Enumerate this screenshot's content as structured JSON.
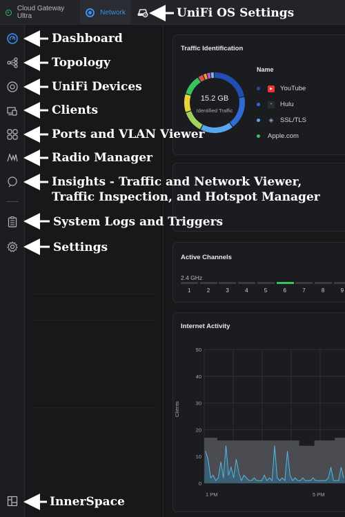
{
  "topbar": {
    "gateway_tab": "Cloud Gateway Ultra",
    "network_tab": "Network"
  },
  "annotations": {
    "os_settings": "UniFi OS Settings",
    "dashboard": "Dashboard",
    "topology": "Topology",
    "devices": "UniFi Devices",
    "clients": "Clients",
    "ports": "Ports and VLAN Viewer",
    "radio": "Radio Manager",
    "insights_line1": "Insights - Traffic and Network Viewer,",
    "insights_line2": "Traffic Inspection, and Hotspot Manager",
    "logs": "System Logs and Triggers",
    "settings": "Settings",
    "innerspace": "InnerSpace"
  },
  "traffic_card": {
    "title": "Traffic Identification",
    "total": "15.2 GB",
    "total_label": "Identified Traffic",
    "legend_header": "Name",
    "legend": [
      {
        "name": "YouTube",
        "color": "#1f4fb3",
        "icon": "youtube-icon"
      },
      {
        "name": "Hulu",
        "color": "#2f6bd6",
        "icon": "hulu-icon"
      },
      {
        "name": "SSL/TLS",
        "color": "#5aa5f0",
        "icon": "shield-icon"
      },
      {
        "name": "Apple.com",
        "color": "#3ac25c",
        "icon": "apple-icon"
      }
    ],
    "donut": [
      {
        "color": "#1f4fb3",
        "value": 22
      },
      {
        "color": "#2f6bd6",
        "value": 18
      },
      {
        "color": "#5aa5f0",
        "value": 18
      },
      {
        "color": "#9fd45a",
        "value": 12
      },
      {
        "color": "#e8d23a",
        "value": 10
      },
      {
        "color": "#3ac25c",
        "value": 11
      },
      {
        "color": "#e05050",
        "value": 3
      },
      {
        "color": "#f09a3a",
        "value": 2
      },
      {
        "color": "#c65ad6",
        "value": 2
      },
      {
        "color": "#7fb3f5",
        "value": 2
      }
    ]
  },
  "channels_card": {
    "title": "Active Channels",
    "band": "2.4 GHz",
    "channels": [
      "1",
      "2",
      "3",
      "4",
      "5",
      "6",
      "7",
      "8",
      "9"
    ],
    "active_channel": "6"
  },
  "internet_card": {
    "title": "Internet Activity",
    "ylabel": "Clients",
    "x_ticks": [
      "1 PM",
      "5 PM"
    ]
  },
  "chart_data": {
    "type": "area",
    "title": "Internet Activity",
    "ylabel": "Clients",
    "ylim": [
      0,
      50
    ],
    "yticks": [
      0,
      10,
      20,
      30,
      40,
      50
    ],
    "x_ticks": [
      "1 PM",
      "5 PM"
    ],
    "series": [
      {
        "name": "",
        "values": [
          17,
          17,
          17,
          17,
          17,
          16,
          16,
          16,
          16,
          16,
          16,
          16,
          16,
          16,
          16,
          16,
          16,
          16,
          16,
          16,
          16,
          16,
          16,
          16,
          16,
          16,
          16,
          16,
          16,
          16,
          16,
          16,
          16,
          16,
          16,
          16,
          16,
          14,
          14,
          14,
          14,
          14,
          14,
          16,
          16,
          16,
          16,
          16,
          16,
          16,
          16,
          17,
          17,
          17,
          17
        ]
      },
      {
        "name": "",
        "values": [
          12,
          9,
          2,
          3,
          1,
          2,
          8,
          2,
          14,
          3,
          6,
          2,
          9,
          4,
          1,
          3,
          2,
          1,
          1,
          2,
          1,
          1,
          1,
          3,
          1,
          2,
          1,
          14,
          2,
          1,
          2,
          1,
          12,
          3,
          1,
          2,
          1,
          1,
          2,
          1,
          1,
          1,
          2,
          1,
          1,
          1,
          1,
          1,
          2,
          6,
          1,
          1,
          1,
          6,
          2
        ]
      }
    ]
  }
}
